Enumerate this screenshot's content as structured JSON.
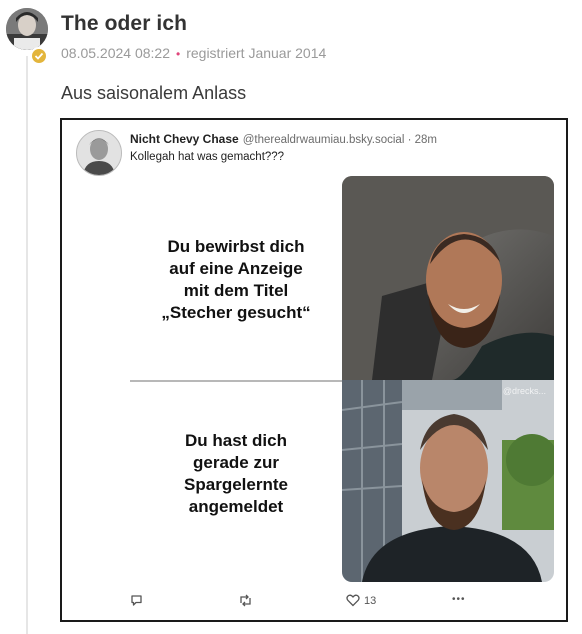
{
  "post": {
    "author": "The oder ich",
    "date": "08.05.2024 08:22",
    "separator": "•",
    "registered": "registriert Januar 2014",
    "text": "Aus saisonalem Anlass",
    "badge_color": "#e3b53c"
  },
  "embed": {
    "name": "Nicht Chevy Chase",
    "handle": "@therealdrwaumiau.bsky.social · 28m",
    "text": "Kollegah hat was gemacht???",
    "meme": {
      "top_lines": [
        "Du bewirbst dich",
        "auf eine Anzeige",
        "mit dem Titel",
        "„Stecher gesucht“"
      ],
      "bottom_lines": [
        "Du hast dich",
        "gerade zur",
        "Spargelernte",
        "angemeldet"
      ],
      "watermark": "@drecks..."
    },
    "actions": {
      "reply_icon": "comment-icon",
      "repost_icon": "repost-icon",
      "like_icon": "heart-icon",
      "like_count": "13",
      "more_label": "•••"
    }
  }
}
